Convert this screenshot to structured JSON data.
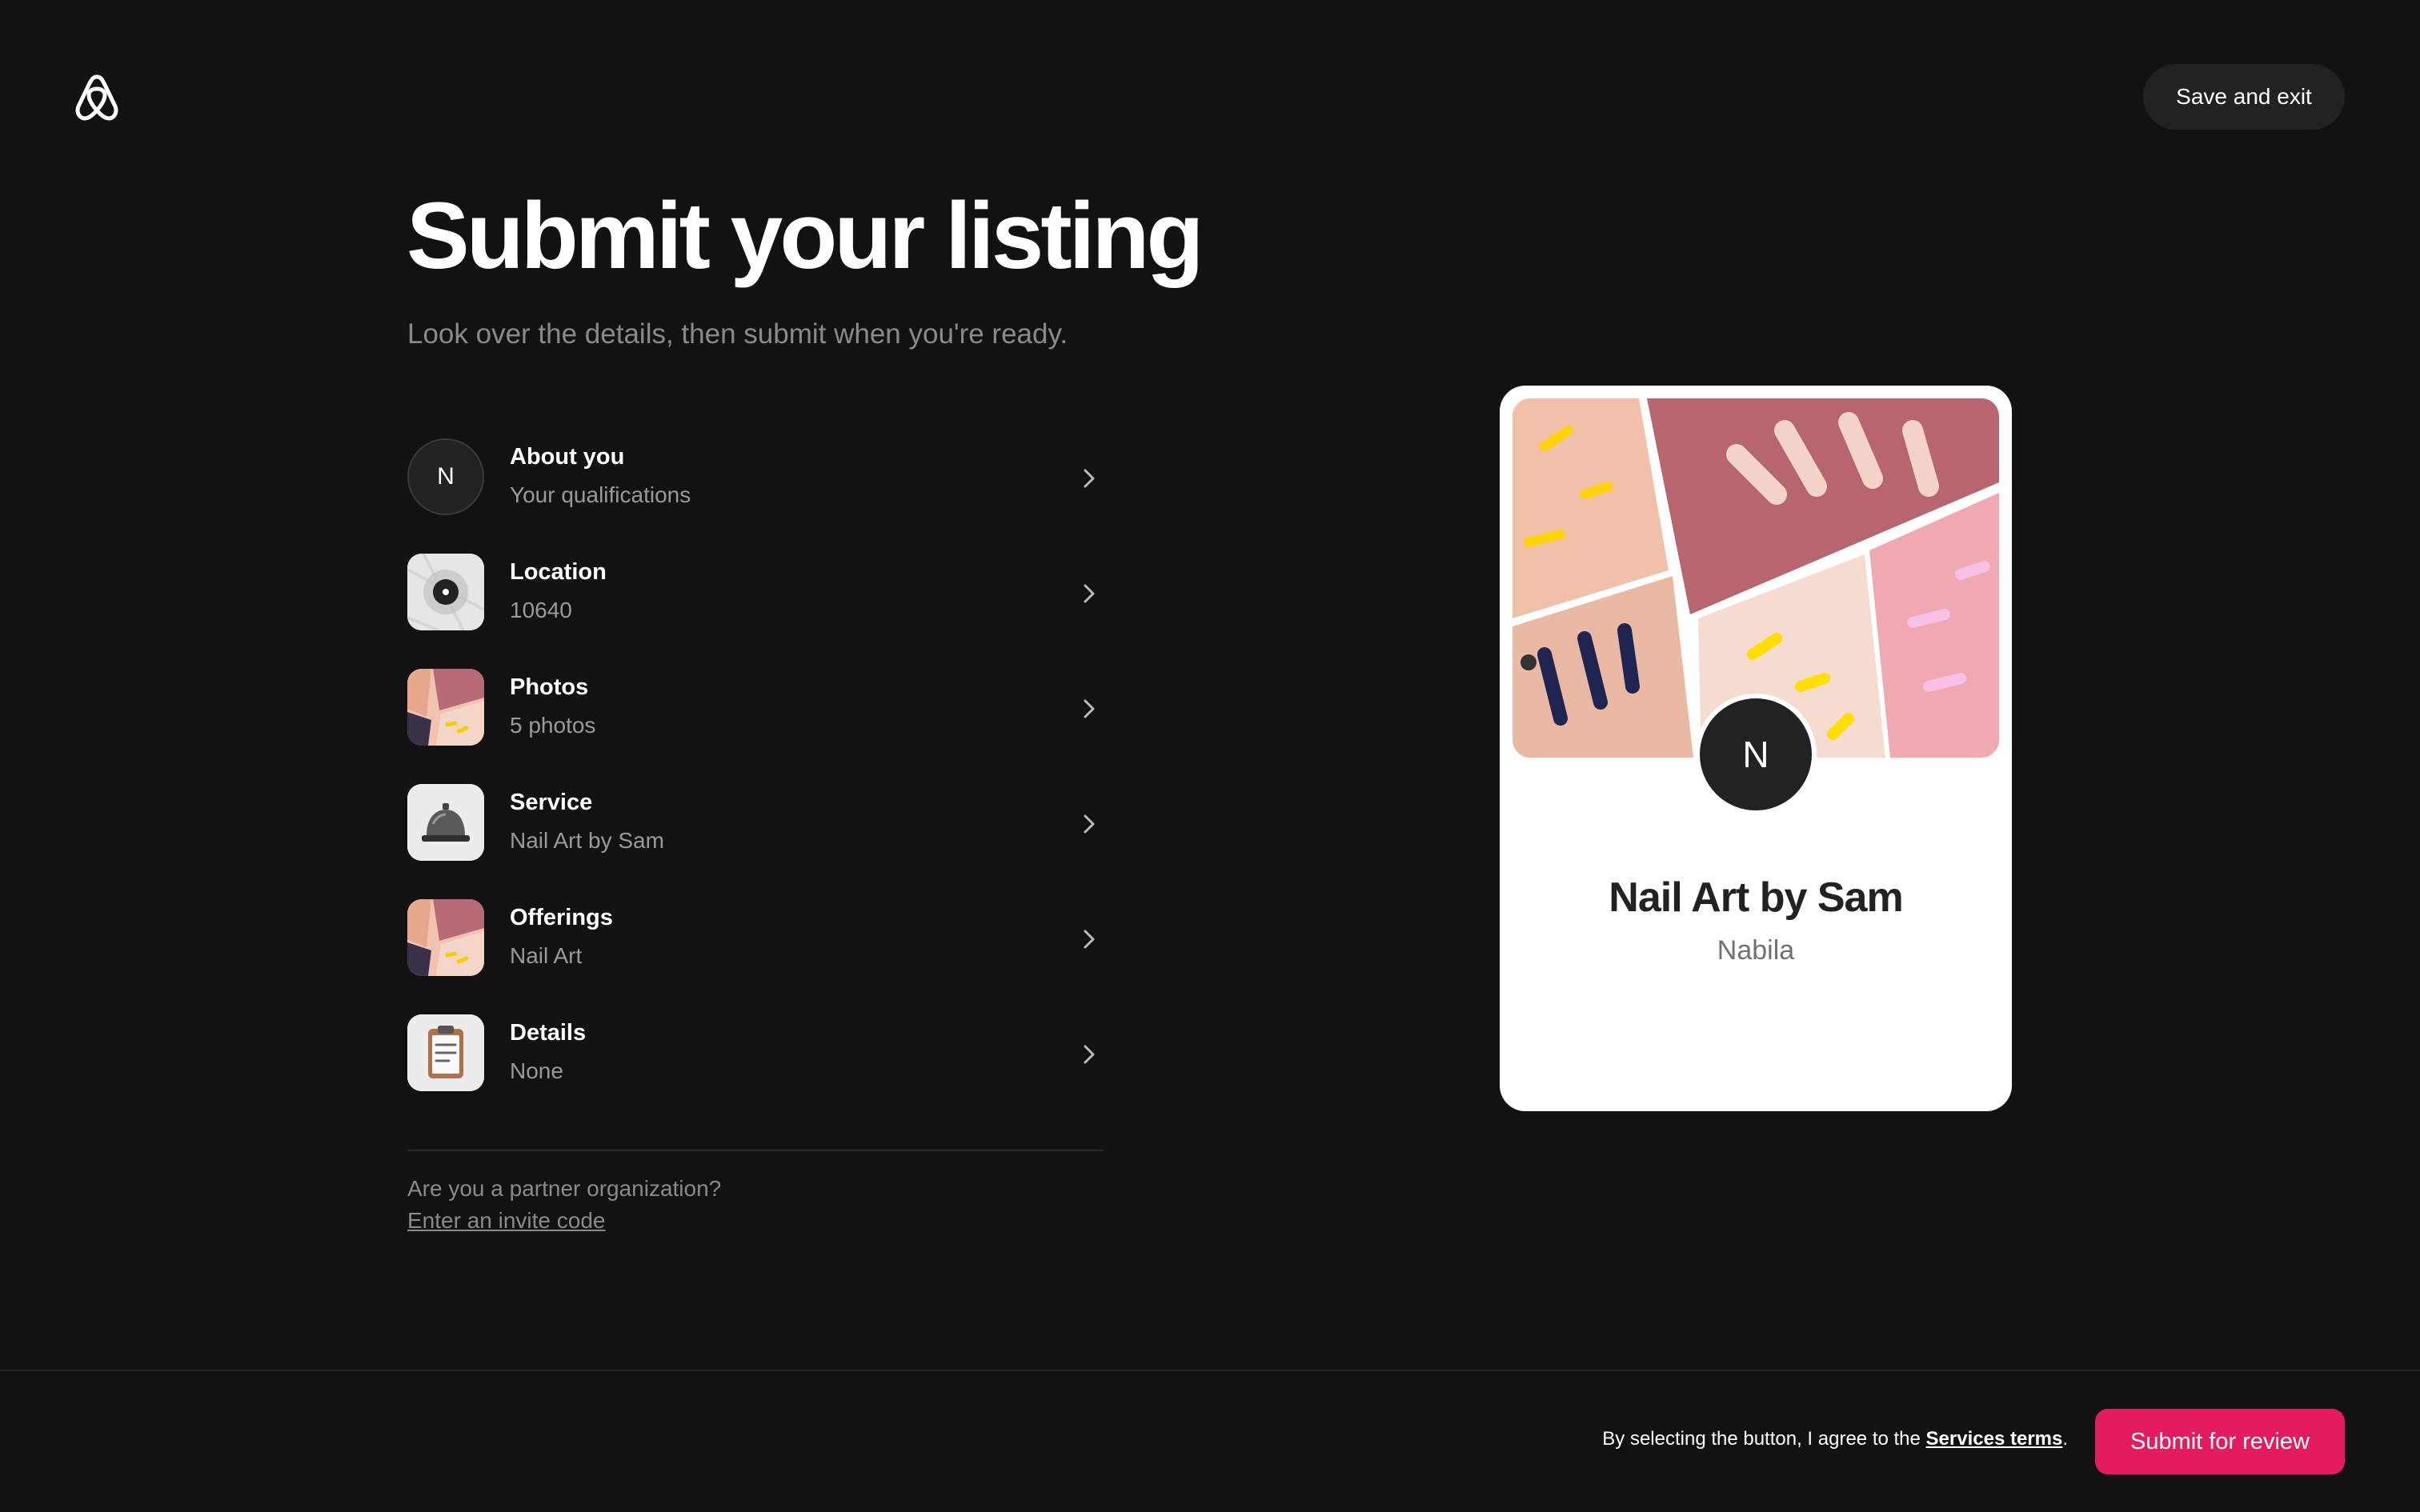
{
  "header": {
    "logo_icon": "airbnb-logo-icon",
    "save_label": "Save and exit"
  },
  "page": {
    "title": "Submit your listing",
    "subtitle": "Look over the details, then submit when you're ready."
  },
  "items": [
    {
      "label": "About you",
      "value": "Your qualifications",
      "thumb": "N",
      "icon": "avatar"
    },
    {
      "label": "Location",
      "value": "10640",
      "icon": "map-pin-icon"
    },
    {
      "label": "Photos",
      "value": "5 photos",
      "icon": "photo-thumbnail"
    },
    {
      "label": "Service",
      "value": "Nail Art by Sam",
      "icon": "service-bell-icon"
    },
    {
      "label": "Offerings",
      "value": "Nail Art",
      "icon": "photo-thumbnail"
    },
    {
      "label": "Details",
      "value": "None",
      "icon": "clipboard-icon"
    }
  ],
  "partner": {
    "question": "Are you a partner organization?",
    "link": "Enter an invite code"
  },
  "card": {
    "avatar_initial": "N",
    "title": "Nail Art by Sam",
    "subtitle": "Nabila"
  },
  "footer": {
    "terms_prefix": "By selecting the button, I agree to the ",
    "terms_link": "Services terms",
    "terms_suffix": ".",
    "submit_label": "Submit for review"
  },
  "colors": {
    "background": "#121212",
    "accent": "#e31c5f"
  }
}
